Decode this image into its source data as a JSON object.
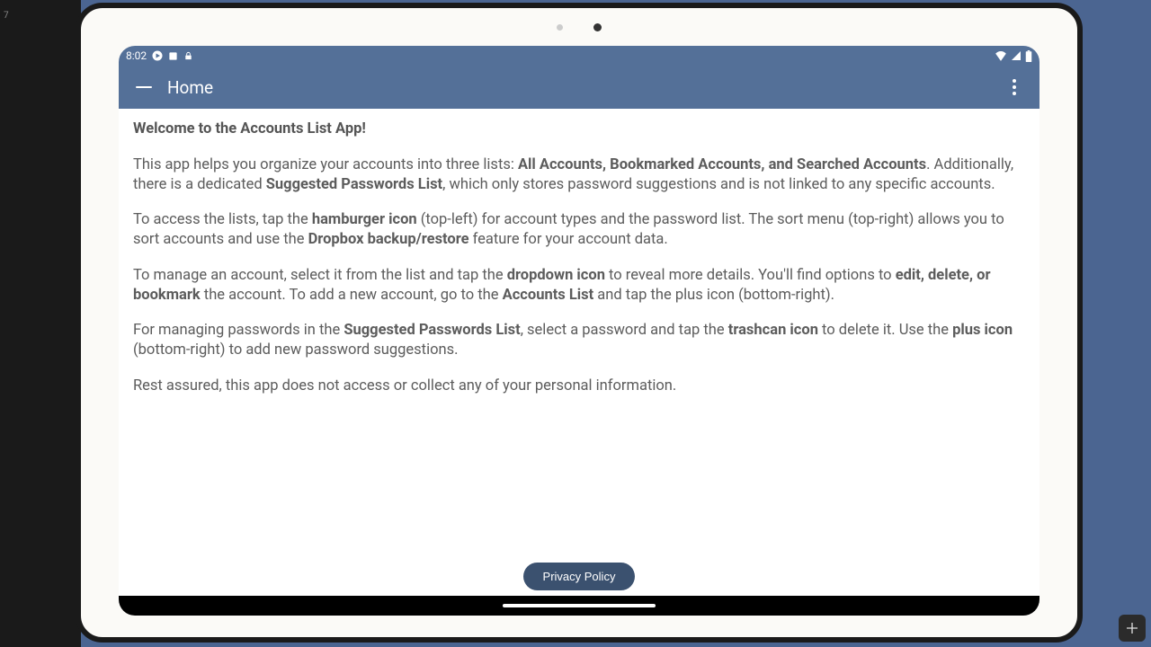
{
  "left_strip_text": "7",
  "statusbar": {
    "time": "8:02"
  },
  "appbar": {
    "title": "Home"
  },
  "content": {
    "welcome_heading": "Welcome to the Accounts List App!",
    "p1_a": "This app helps you organize your accounts into three lists: ",
    "p1_bold1": "All Accounts, Bookmarked Accounts, and Searched Accounts",
    "p1_b": ". Additionally, there is a dedicated ",
    "p1_bold2": "Suggested Passwords List",
    "p1_c": ", which only stores password suggestions and is not linked to any specific accounts.",
    "p2_a": "To access the lists, tap the ",
    "p2_bold1": "hamburger icon",
    "p2_b": " (top-left) for account types and the password list. The sort menu (top-right) allows you to sort accounts and use the ",
    "p2_bold2": "Dropbox backup/restore",
    "p2_c": " feature for your account data.",
    "p3_a": "To manage an account, select it from the list and tap the ",
    "p3_bold1": "dropdown icon",
    "p3_b": " to reveal more details. You'll find options to ",
    "p3_bold2": "edit, delete, or bookmark",
    "p3_c": " the account. To add a new account, go to the ",
    "p3_bold3": "Accounts List",
    "p3_d": " and tap the plus icon (bottom-right).",
    "p4_a": "For managing passwords in the ",
    "p4_bold1": "Suggested Passwords List",
    "p4_b": ", select a password and tap the ",
    "p4_bold2": "trashcan icon",
    "p4_c": " to delete it. Use the ",
    "p4_bold3": "plus icon",
    "p4_d": " (bottom-right) to add new password suggestions.",
    "p5": "Rest assured, this app does not access or collect any of your personal information."
  },
  "privacy_button": "Privacy Policy"
}
